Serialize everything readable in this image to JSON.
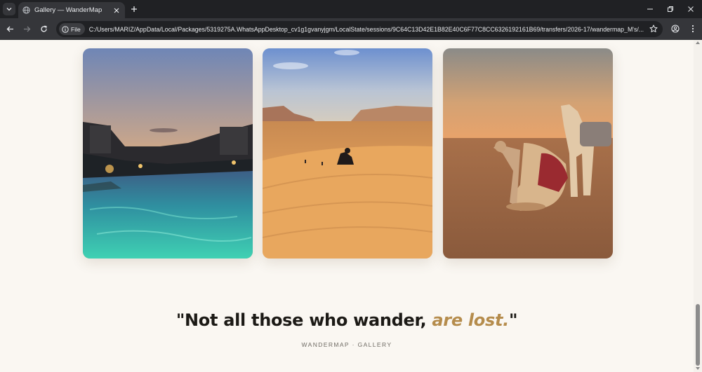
{
  "browser": {
    "tab_title": "Gallery — WanderMap",
    "file_chip": "File",
    "url": "C:/Users/MARIZ/AppData/Local/Packages/5319275A.WhatsAppDesktop_cv1g1gvanyjgm/LocalState/sessions/9C64C13D42E1B82E40C6F77C8CC6326192161B69/transfers/2026-17/wandermap_M's/..."
  },
  "gallery": {
    "photos": [
      {
        "subject": "resort pool at sunset"
      },
      {
        "subject": "desert dunes with people"
      },
      {
        "subject": "camels in the desert at sunset"
      }
    ]
  },
  "quote": {
    "open": "\"Not all those who wander, ",
    "emphasis": "are lost.",
    "close": "\""
  },
  "footer": {
    "label": "WANDERMAP · GALLERY"
  },
  "colors": {
    "accent": "#b58c4c",
    "background": "#faf7f2",
    "chrome": "#35363a"
  }
}
